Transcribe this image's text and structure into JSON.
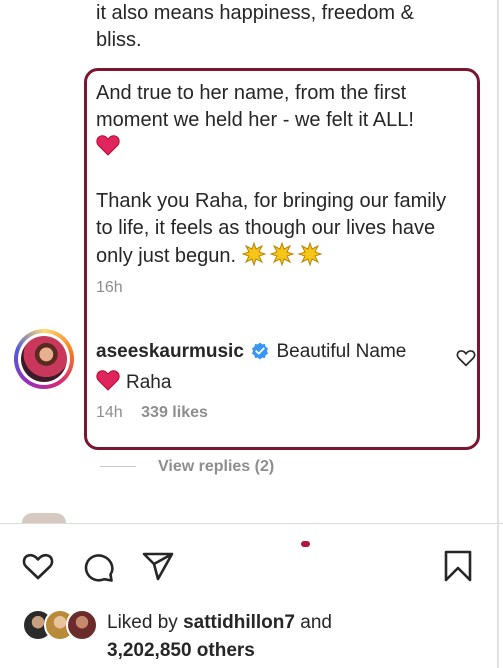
{
  "caption": {
    "top_text": "it also means happiness, freedom & bliss.",
    "para1": "And true to her name, from the first moment we held her - we felt it ALL!",
    "para2": "Thank you Raha, for bringing our family to life, it feels as though our lives have only just begun.",
    "time": "16h"
  },
  "comment": {
    "username": "aseeskaurmusic",
    "text_part1": "Beautiful Name",
    "text_part2": "Raha",
    "time": "14h",
    "likes": "339 likes",
    "view_replies": "View replies (2)"
  },
  "likes_summary": {
    "prefix": "Liked by",
    "user": "sattidhillon7",
    "conj": "and",
    "others": "3,202,850 others"
  },
  "colors": {
    "highlight_border": "#7a1630",
    "heart_red": "#e0245e",
    "verified_blue": "#3897f0",
    "secondary_text": "#8e8e8e"
  }
}
